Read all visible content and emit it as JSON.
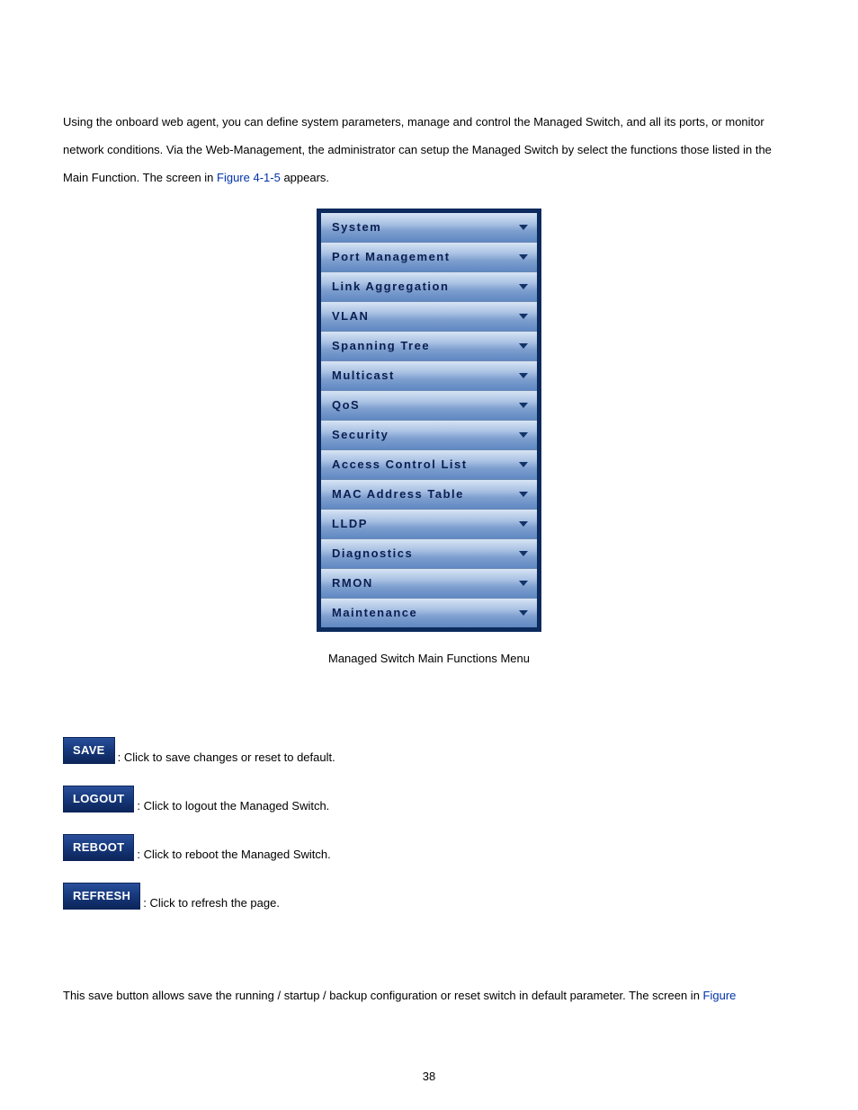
{
  "intro_pre": "Using the onboard web agent, you can define system parameters, manage and control the Managed Switch, and all its ports, or monitor network conditions. Via the Web-Management, the administrator can setup the Managed Switch by select the functions those listed in the Main Function. The screen in ",
  "intro_link": "Figure 4-1-5",
  "intro_post": " appears.",
  "menu": {
    "items": [
      {
        "label": "System"
      },
      {
        "label": "Port Management"
      },
      {
        "label": "Link Aggregation"
      },
      {
        "label": "VLAN"
      },
      {
        "label": "Spanning Tree"
      },
      {
        "label": "Multicast"
      },
      {
        "label": "QoS"
      },
      {
        "label": "Security"
      },
      {
        "label": "Access Control List"
      },
      {
        "label": "MAC Address Table"
      },
      {
        "label": "LLDP"
      },
      {
        "label": "Diagnostics"
      },
      {
        "label": "RMON"
      },
      {
        "label": "Maintenance"
      }
    ]
  },
  "caption": "Managed Switch Main Functions Menu",
  "actions": [
    {
      "button": "SAVE",
      "desc": ": Click to save changes or reset to default."
    },
    {
      "button": "LOGOUT",
      "desc": ": Click to logout the Managed Switch."
    },
    {
      "button": "REBOOT",
      "desc": ": Click to reboot the Managed Switch."
    },
    {
      "button": "REFRESH",
      "desc": ": Click to refresh the page."
    }
  ],
  "footer_pre": "This save button allows save the running / startup / backup configuration or reset switch in default parameter. The screen in ",
  "footer_link": "Figure",
  "page_number": "38"
}
